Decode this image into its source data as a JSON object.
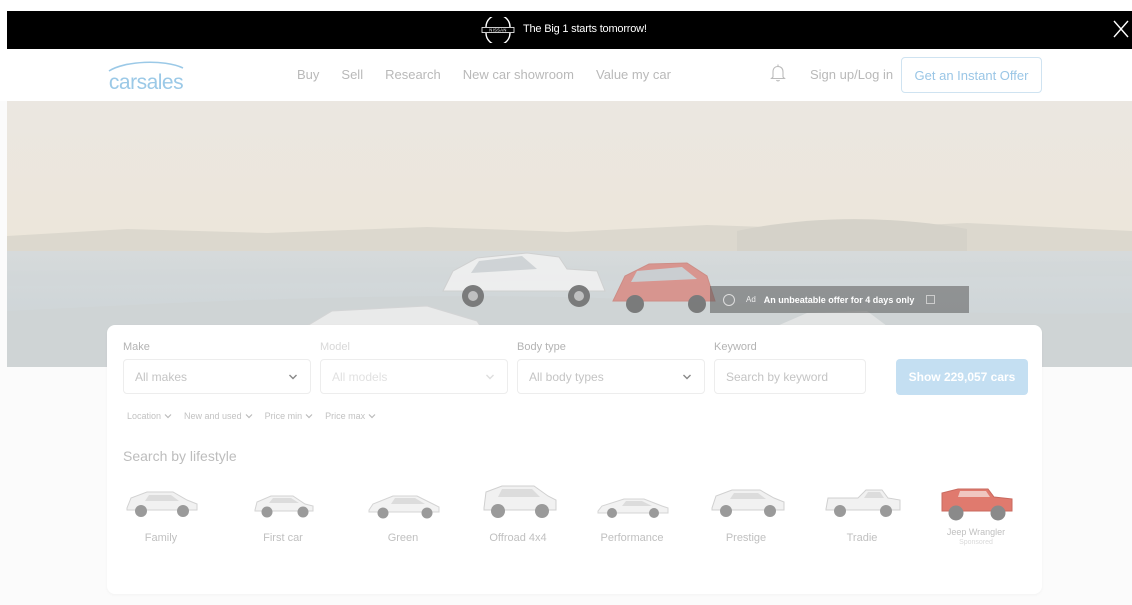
{
  "promo": {
    "brand_icon": "nissan-logo-icon",
    "text": "The Big 1 starts tomorrow!"
  },
  "header": {
    "logo": "carsales",
    "nav": [
      "Buy",
      "Sell",
      "Research",
      "New car showroom",
      "Value my car"
    ],
    "notification_icon": "bell-icon",
    "signin": "Sign up/Log in",
    "offer_button": "Get an Instant Offer"
  },
  "hero_ad": {
    "tag": "Ad",
    "text": "An unbeatable offer for 4 days only"
  },
  "search": {
    "make_label": "Make",
    "make_value": "All makes",
    "model_label": "Model",
    "model_value": "All models",
    "body_label": "Body type",
    "body_value": "All body types",
    "keyword_label": "Keyword",
    "keyword_placeholder": "Search by keyword",
    "show_button": "Show 229,057 cars",
    "filters": [
      "Location",
      "New and used",
      "Price min",
      "Price max"
    ]
  },
  "lifestyle": {
    "title": "Search by lifestyle",
    "items": [
      {
        "label": "Family"
      },
      {
        "label": "First car"
      },
      {
        "label": "Green"
      },
      {
        "label": "Offroad 4x4"
      },
      {
        "label": "Performance"
      },
      {
        "label": "Prestige"
      },
      {
        "label": "Tradie"
      },
      {
        "label": "Jeep Wrangler",
        "sub": "Sponsored"
      }
    ]
  },
  "colors": {
    "accent": "#c4dff2",
    "offer_border": "#cfe3f1",
    "wrangler_red": "#e07a6e"
  }
}
